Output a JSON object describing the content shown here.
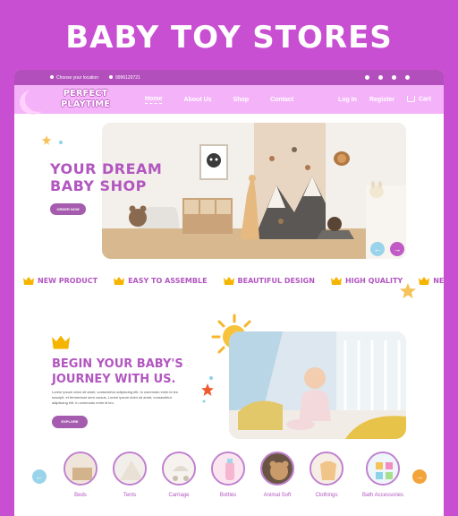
{
  "headline": "BABY TOY STORES",
  "topbar": {
    "location": "Choose your location",
    "phone": "9996120721"
  },
  "brand": {
    "line1": "PERFECT",
    "line2": "PLAYTIME"
  },
  "nav": {
    "home": "Home",
    "about": "About Us",
    "shop": "Shop",
    "contact": "Contact",
    "login": "Log In",
    "register": "Register",
    "cart": "Cart"
  },
  "hero": {
    "title_line1": "YOUR DREAM",
    "title_line2": "BABY SHOP",
    "button": "ORDER NOW"
  },
  "features": [
    "NEW PRODUCT",
    "EASY TO ASSEMBLE",
    "BEAUTIFUL DESIGN",
    "HIGH QUALITY",
    "NEW P"
  ],
  "section2": {
    "title_line1": "BEGIN YOUR BABY'S",
    "title_line2": "JOURNEY WITH US.",
    "body": "Lorem ipsum dolor sit amet, consectetur adipiscing elit. In commodo enim id leo suscipit, et fermentum sem cursus. Lorem ipsum dolor sit amet, consectetur adipiscing elit. In commodo enim id leo.",
    "button": "EXPLORE"
  },
  "categories": [
    "Beds",
    "Tents",
    "Carriage",
    "Bottles",
    "Animal Soft",
    "Clothings",
    "Bath Accessories"
  ],
  "colors": {
    "background": "#c94fd2",
    "accent": "#b256c0",
    "nav": "#f4b3f8",
    "crown": "#f5b400",
    "arrow_prev": "#9ad4ea",
    "arrow_next": "#c05bc6",
    "arrow_right_orange": "#f2a33a"
  }
}
